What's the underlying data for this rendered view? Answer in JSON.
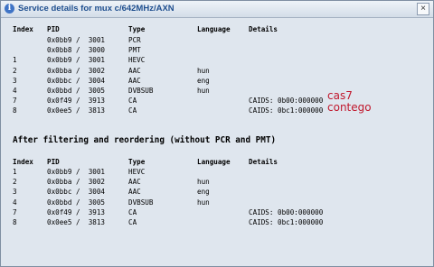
{
  "window": {
    "title": "Service details for mux c/642MHz/AXN",
    "close_symbol": "×"
  },
  "columns": {
    "index": "Index",
    "pid": "PID",
    "type": "Type",
    "language": "Language",
    "details": "Details"
  },
  "table1_rows": [
    {
      "index": "",
      "pid": "0x0bb9 /  3001",
      "type": "PCR",
      "language": "",
      "details": ""
    },
    {
      "index": "",
      "pid": "0x0bb8 /  3000",
      "type": "PMT",
      "language": "",
      "details": ""
    },
    {
      "index": "1",
      "pid": "0x0bb9 /  3001",
      "type": "HEVC",
      "language": "",
      "details": ""
    },
    {
      "index": "2",
      "pid": "0x0bba /  3002",
      "type": "AAC",
      "language": "hun",
      "details": ""
    },
    {
      "index": "3",
      "pid": "0x0bbc /  3004",
      "type": "AAC",
      "language": "eng",
      "details": ""
    },
    {
      "index": "4",
      "pid": "0x0bbd /  3005",
      "type": "DVBSUB",
      "language": "hun",
      "details": ""
    },
    {
      "index": "7",
      "pid": "0x0f49 /  3913",
      "type": "CA",
      "language": "",
      "details": "CAIDS: 0b00:000000"
    },
    {
      "index": "8",
      "pid": "0x0ee5 /  3813",
      "type": "CA",
      "language": "",
      "details": "CAIDS: 0bc1:000000"
    }
  ],
  "subtitle": "After filtering and reordering (without PCR and PMT)",
  "table2_rows": [
    {
      "index": "1",
      "pid": "0x0bb9 /  3001",
      "type": "HEVC",
      "language": "",
      "details": ""
    },
    {
      "index": "2",
      "pid": "0x0bba /  3002",
      "type": "AAC",
      "language": "hun",
      "details": ""
    },
    {
      "index": "3",
      "pid": "0x0bbc /  3004",
      "type": "AAC",
      "language": "eng",
      "details": ""
    },
    {
      "index": "4",
      "pid": "0x0bbd /  3005",
      "type": "DVBSUB",
      "language": "hun",
      "details": ""
    },
    {
      "index": "7",
      "pid": "0x0f49 /  3913",
      "type": "CA",
      "language": "",
      "details": "CAIDS: 0b00:000000"
    },
    {
      "index": "8",
      "pid": "0x0ee5 /  3813",
      "type": "CA",
      "language": "",
      "details": "CAIDS: 0bc1:000000"
    }
  ],
  "annotations": {
    "cas7": "cas7",
    "contego": "contego",
    "color": "#c0172c"
  }
}
